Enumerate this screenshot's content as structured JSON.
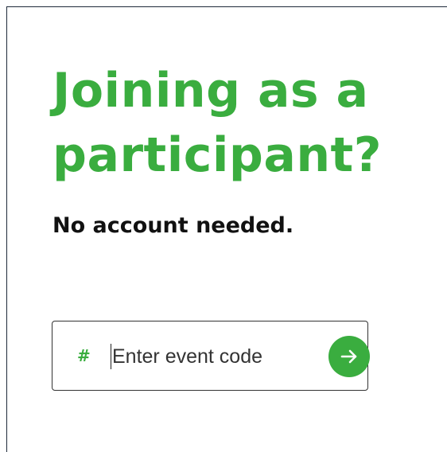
{
  "join": {
    "headline": "Joining as a participant?",
    "subline": "No account needed.",
    "code_prefix": "#",
    "code_placeholder": "Enter event code",
    "code_value": ""
  },
  "icons": {
    "prefix": "hash-icon",
    "submit": "arrow-right-icon"
  },
  "colors": {
    "brand_green": "#3aad3f",
    "text_dark": "#111111",
    "border": "#333333"
  }
}
